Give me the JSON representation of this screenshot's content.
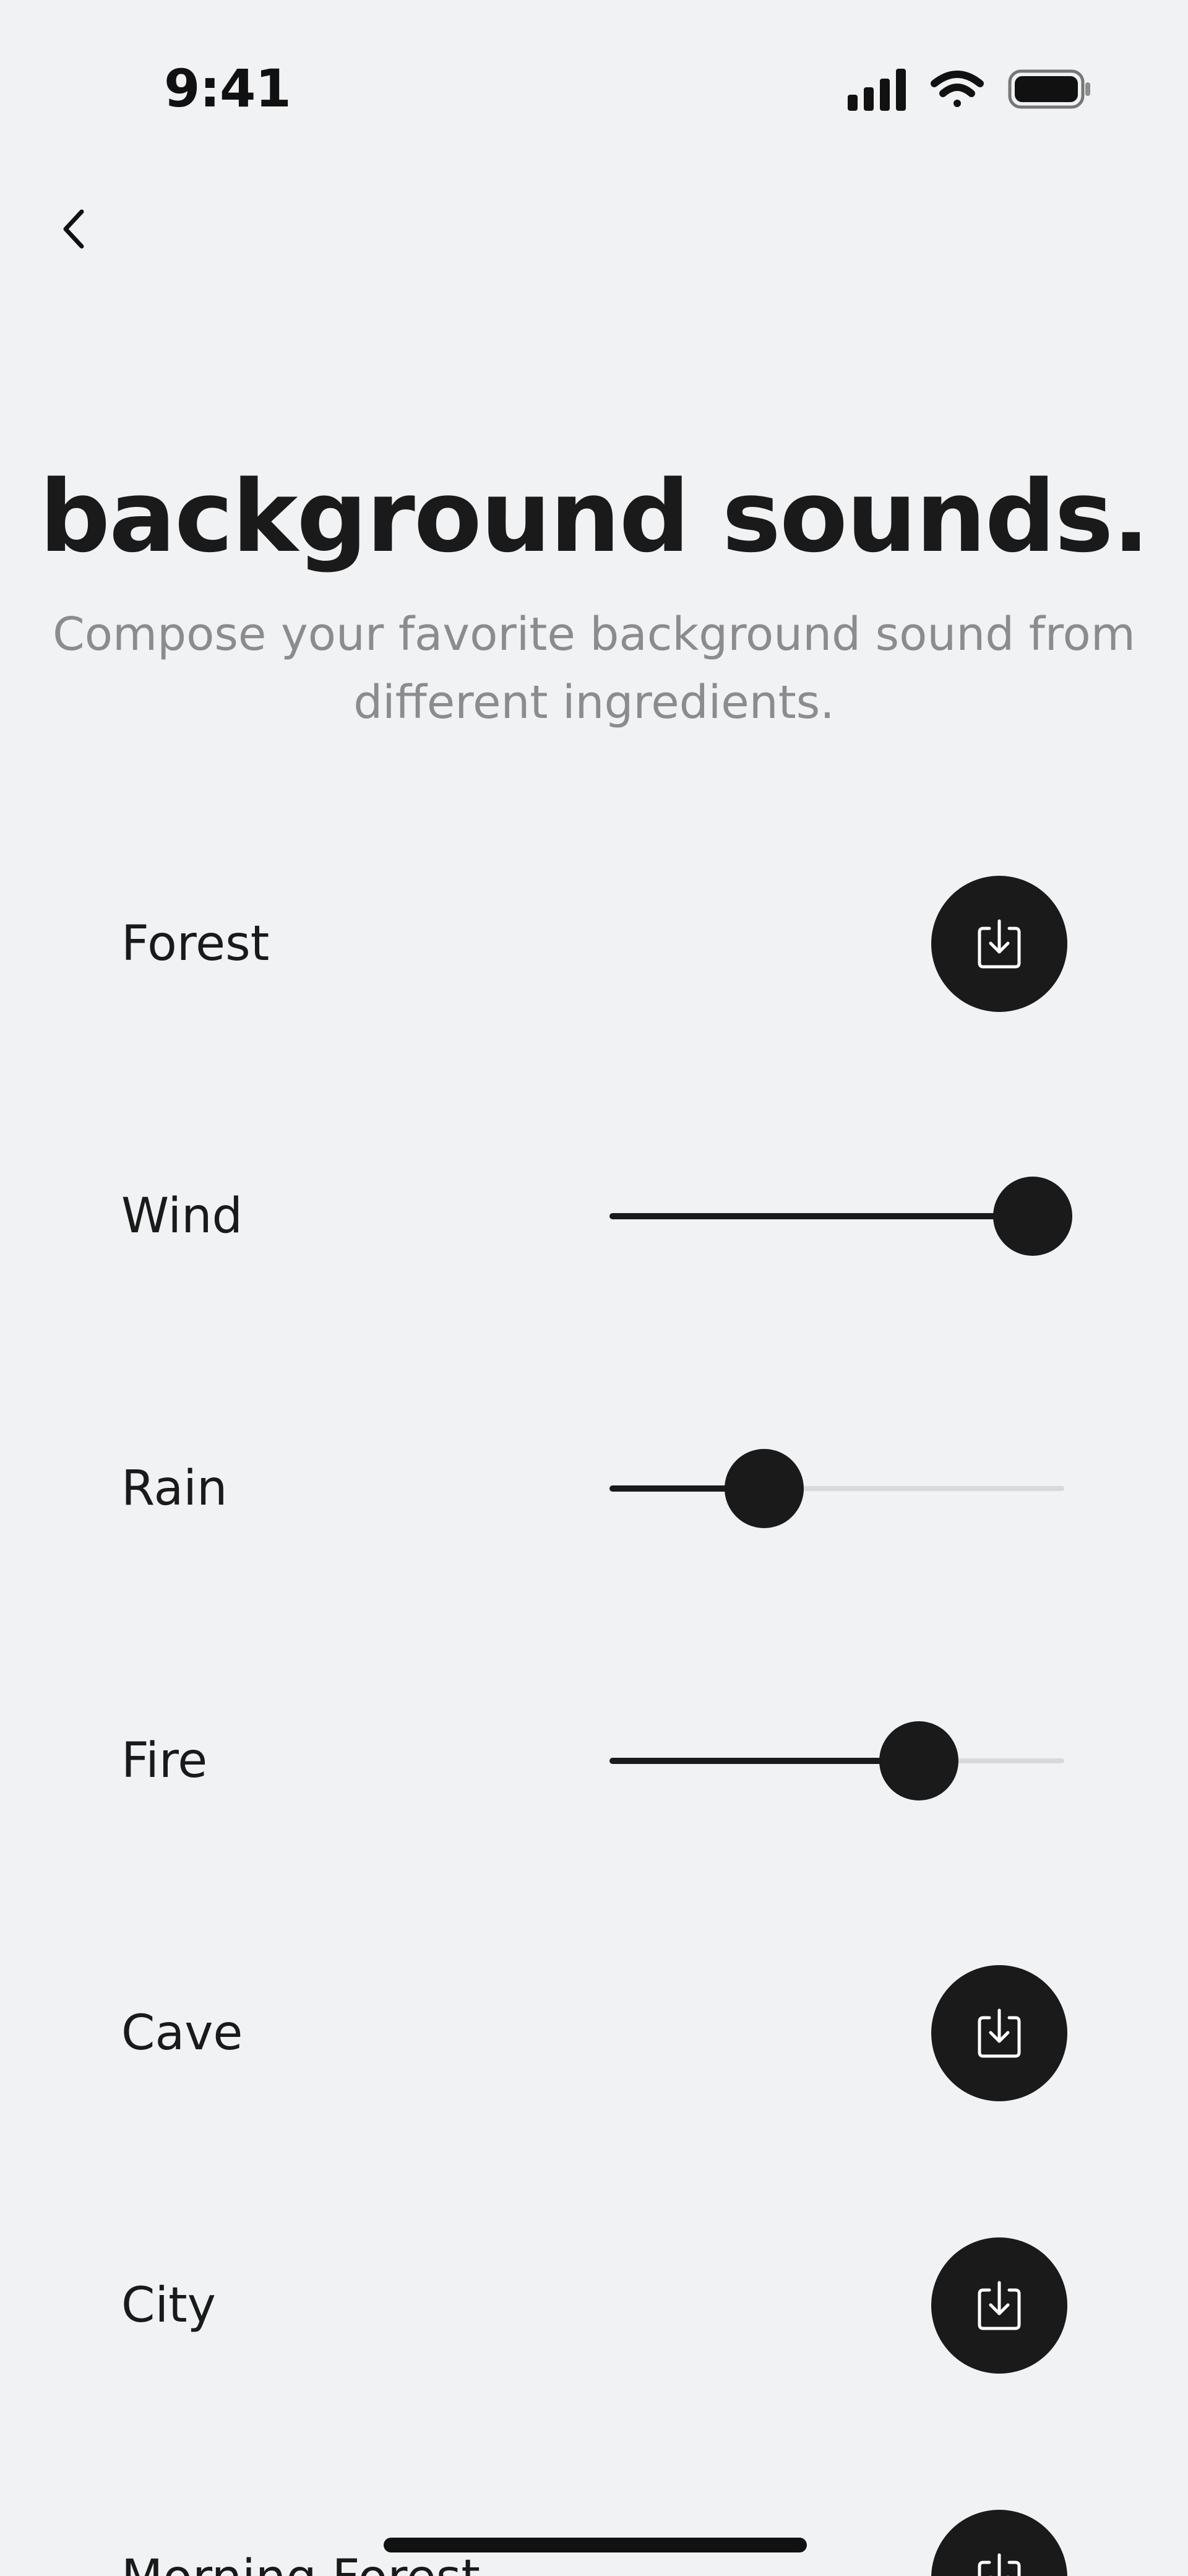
{
  "status_bar": {
    "time": "9:41",
    "icons": [
      "signal-icon",
      "wifi-icon",
      "battery-icon"
    ]
  },
  "nav": {
    "back_icon": "chevron-left-icon"
  },
  "header": {
    "title": "background sounds.",
    "subtitle_line1": "Compose your favorite background sound from",
    "subtitle_line2": "different ingredients."
  },
  "sounds": [
    {
      "label": "Forest",
      "state": "download",
      "icon": "download-icon"
    },
    {
      "label": "Wind",
      "state": "slider",
      "volume": 0.93
    },
    {
      "label": "Rain",
      "state": "slider",
      "volume": 0.34
    },
    {
      "label": "Fire",
      "state": "slider",
      "volume": 0.68
    },
    {
      "label": "Cave",
      "state": "download",
      "icon": "download-icon"
    },
    {
      "label": "City",
      "state": "download",
      "icon": "download-icon"
    },
    {
      "label": "Morning Forest",
      "state": "download",
      "icon": "download-icon"
    }
  ],
  "colors": {
    "background": "#f1f2f4",
    "accent": "#1a1a1a",
    "track": "#d9d9db",
    "subtitle": "#8c8c8e"
  }
}
